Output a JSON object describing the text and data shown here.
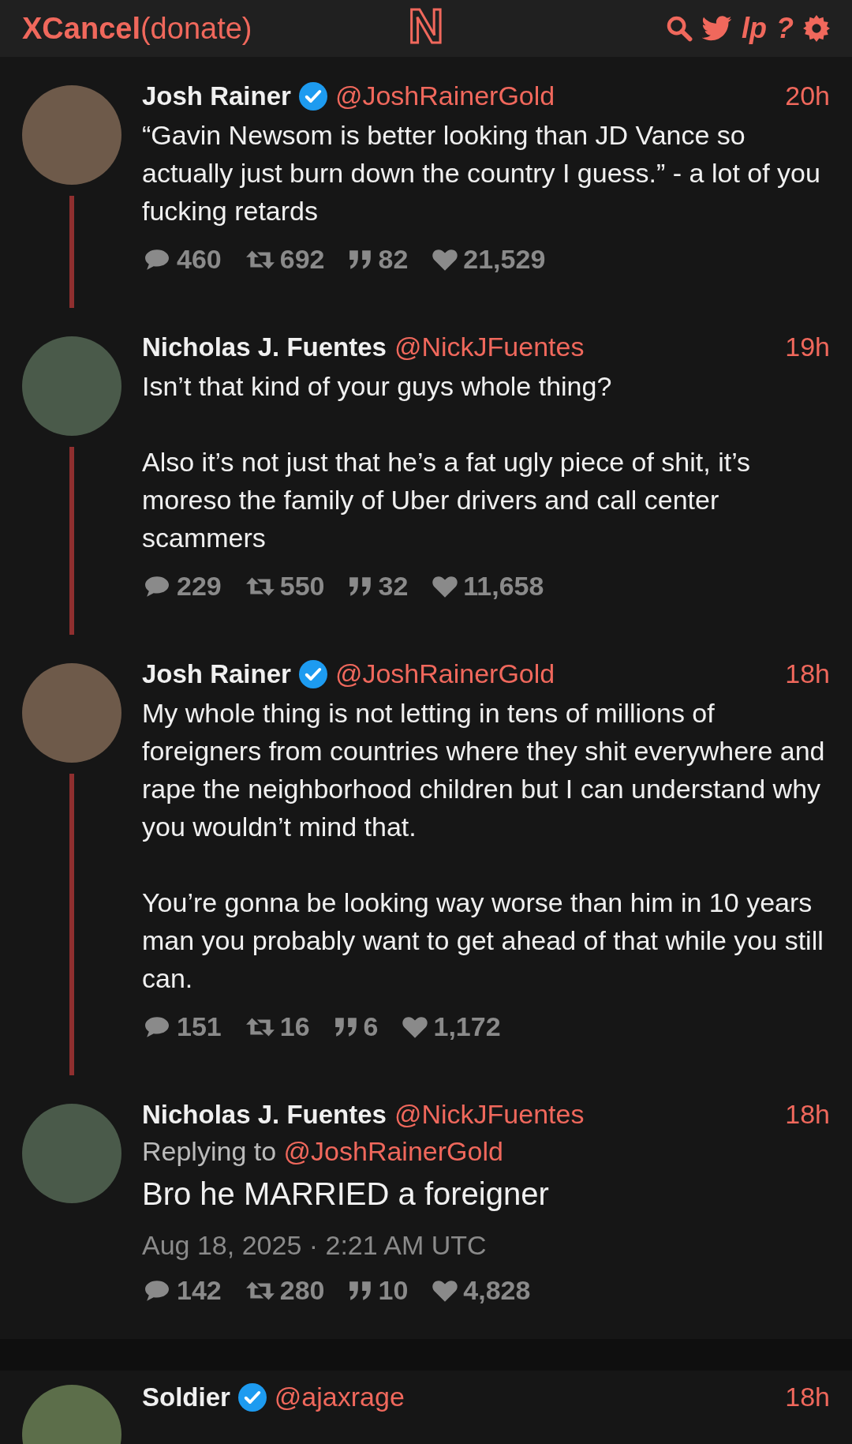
{
  "header": {
    "brand": "XCancel",
    "donate": "(donate)",
    "logo": "N",
    "nav": [
      {
        "kind": "search"
      },
      {
        "kind": "bird"
      },
      {
        "kind": "text",
        "label": "lp"
      },
      {
        "kind": "text",
        "label": "?"
      },
      {
        "kind": "gear"
      }
    ]
  },
  "thread": [
    {
      "name": "Josh Rainer",
      "verified": true,
      "handle": "@JoshRainerGold",
      "time": "20h",
      "thread_line": true,
      "main": false,
      "body": [
        "“Gavin Newsom is better looking than JD Vance so actually just burn down the country I guess.” - a lot of you fucking retards"
      ],
      "stats": {
        "replies": "460",
        "retweets": "692",
        "quotes": "82",
        "likes": "21,529"
      }
    },
    {
      "name": "Nicholas J. Fuentes",
      "verified": false,
      "handle": "@NickJFuentes",
      "time": "19h",
      "thread_line": true,
      "main": false,
      "body": [
        "Isn’t that kind of your guys whole thing?",
        "Also it’s not just that he’s a fat ugly piece of shit, it’s moreso the family of Uber drivers and call center scammers"
      ],
      "stats": {
        "replies": "229",
        "retweets": "550",
        "quotes": "32",
        "likes": "11,658"
      }
    },
    {
      "name": "Josh Rainer",
      "verified": true,
      "handle": "@JoshRainerGold",
      "time": "18h",
      "thread_line": true,
      "main": false,
      "body": [
        "My whole thing is not letting in tens of millions of foreigners from countries where they shit everywhere and rape the neighborhood children but I can understand why you wouldn’t mind that.",
        "You’re gonna be looking way worse than him in 10 years man you probably want to get ahead of that while you still can."
      ],
      "stats": {
        "replies": "151",
        "retweets": "16",
        "quotes": "6",
        "likes": "1,172"
      }
    },
    {
      "name": "Nicholas J. Fuentes",
      "verified": false,
      "handle": "@NickJFuentes",
      "time": "18h",
      "thread_line": false,
      "main": true,
      "replying_label": "Replying to",
      "replying_to": "@JoshRainerGold",
      "body": [
        "Bro he MARRIED a foreigner"
      ],
      "date": "Aug 18, 2025 · 2:21 AM UTC",
      "stats": {
        "replies": "142",
        "retweets": "280",
        "quotes": "10",
        "likes": "4,828"
      }
    }
  ],
  "replies": [
    {
      "name": "Soldier",
      "verified": true,
      "handle": "@ajaxrage",
      "time": "18h"
    }
  ]
}
